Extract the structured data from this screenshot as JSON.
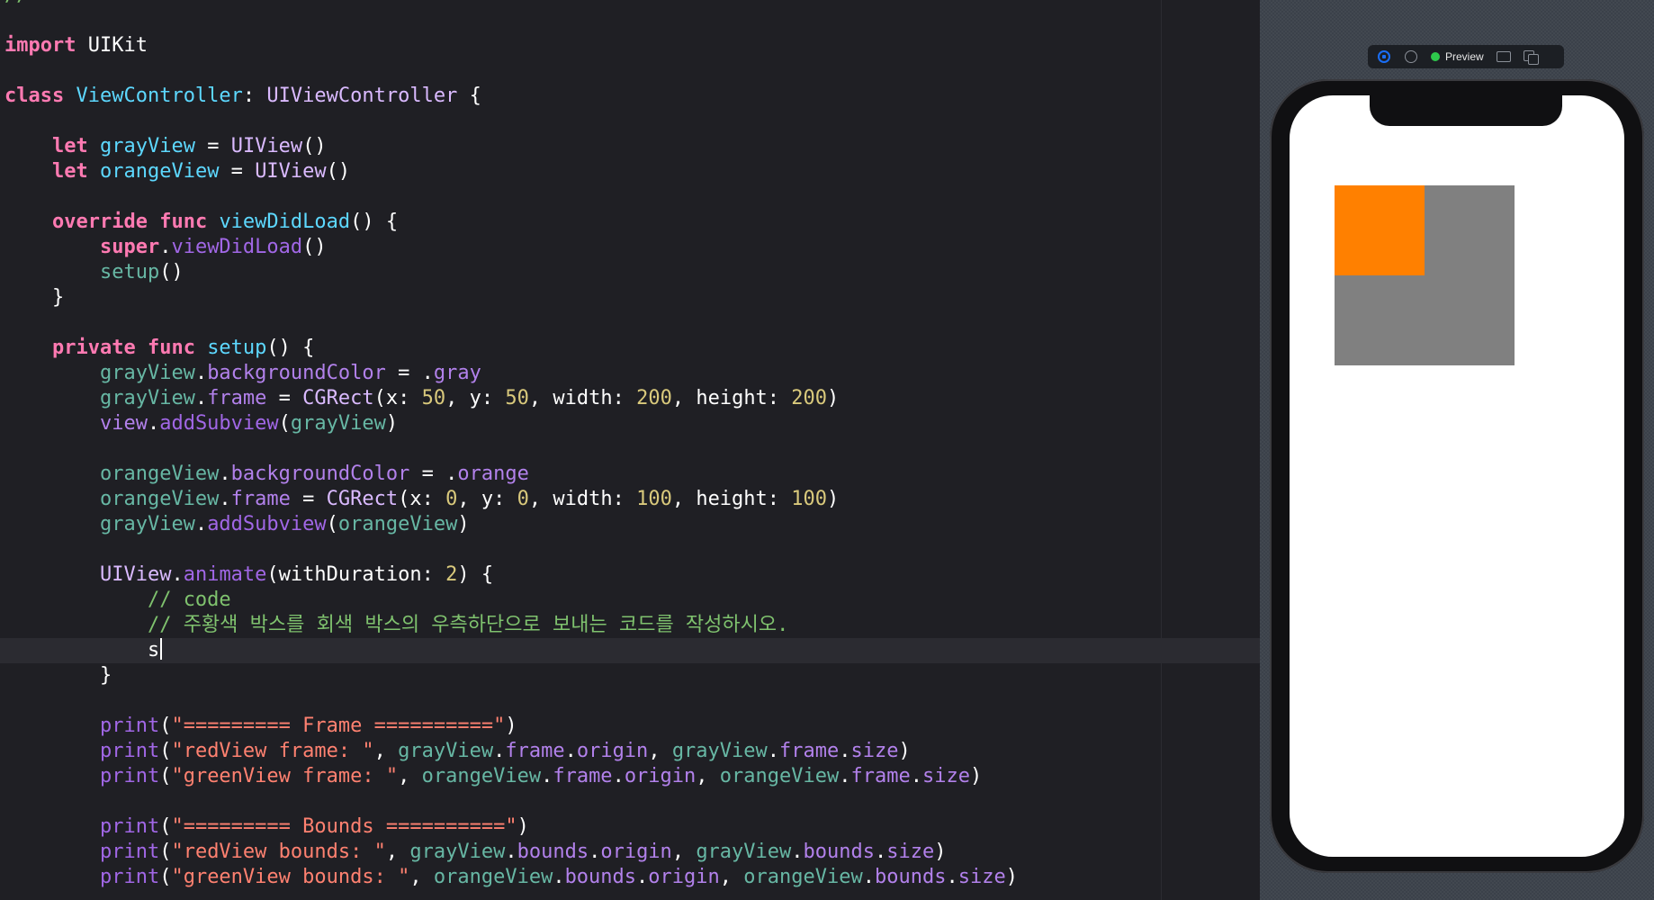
{
  "editor": {
    "lines": [
      [
        {
          "c": "cmt",
          "t": "//"
        }
      ],
      [],
      [
        {
          "c": "kw",
          "t": "import"
        },
        {
          "c": "plain",
          "t": " UIKit"
        }
      ],
      [],
      [
        {
          "c": "kw",
          "t": "class"
        },
        {
          "c": "plain",
          "t": " "
        },
        {
          "c": "type",
          "t": "ViewController"
        },
        {
          "c": "plain",
          "t": ": "
        },
        {
          "c": "cls",
          "t": "UIViewController"
        },
        {
          "c": "plain",
          "t": " {"
        }
      ],
      [],
      [
        {
          "c": "plain",
          "t": "    "
        },
        {
          "c": "kw",
          "t": "let"
        },
        {
          "c": "plain",
          "t": " "
        },
        {
          "c": "type",
          "t": "grayView"
        },
        {
          "c": "plain",
          "t": " = "
        },
        {
          "c": "cls",
          "t": "UIView"
        },
        {
          "c": "plain",
          "t": "()"
        }
      ],
      [
        {
          "c": "plain",
          "t": "    "
        },
        {
          "c": "kw",
          "t": "let"
        },
        {
          "c": "plain",
          "t": " "
        },
        {
          "c": "type",
          "t": "orangeView"
        },
        {
          "c": "plain",
          "t": " = "
        },
        {
          "c": "cls",
          "t": "UIView"
        },
        {
          "c": "plain",
          "t": "()"
        }
      ],
      [],
      [
        {
          "c": "plain",
          "t": "    "
        },
        {
          "c": "kw",
          "t": "override"
        },
        {
          "c": "plain",
          "t": " "
        },
        {
          "c": "kw",
          "t": "func"
        },
        {
          "c": "plain",
          "t": " "
        },
        {
          "c": "type",
          "t": "viewDidLoad"
        },
        {
          "c": "plain",
          "t": "() {"
        }
      ],
      [
        {
          "c": "plain",
          "t": "        "
        },
        {
          "c": "kw",
          "t": "super"
        },
        {
          "c": "plain",
          "t": "."
        },
        {
          "c": "sysfn",
          "t": "viewDidLoad"
        },
        {
          "c": "plain",
          "t": "()"
        }
      ],
      [
        {
          "c": "plain",
          "t": "        "
        },
        {
          "c": "id",
          "t": "setup"
        },
        {
          "c": "plain",
          "t": "()"
        }
      ],
      [
        {
          "c": "plain",
          "t": "    }"
        }
      ],
      [],
      [
        {
          "c": "plain",
          "t": "    "
        },
        {
          "c": "kw",
          "t": "private"
        },
        {
          "c": "plain",
          "t": " "
        },
        {
          "c": "kw",
          "t": "func"
        },
        {
          "c": "plain",
          "t": " "
        },
        {
          "c": "type",
          "t": "setup"
        },
        {
          "c": "plain",
          "t": "() {"
        }
      ],
      [
        {
          "c": "plain",
          "t": "        "
        },
        {
          "c": "id",
          "t": "grayView"
        },
        {
          "c": "plain",
          "t": "."
        },
        {
          "c": "mem",
          "t": "backgroundColor"
        },
        {
          "c": "plain",
          "t": " = ."
        },
        {
          "c": "mem",
          "t": "gray"
        }
      ],
      [
        {
          "c": "plain",
          "t": "        "
        },
        {
          "c": "id",
          "t": "grayView"
        },
        {
          "c": "plain",
          "t": "."
        },
        {
          "c": "mem",
          "t": "frame"
        },
        {
          "c": "plain",
          "t": " = "
        },
        {
          "c": "cls",
          "t": "CGRect"
        },
        {
          "c": "plain",
          "t": "(x: "
        },
        {
          "c": "num",
          "t": "50"
        },
        {
          "c": "plain",
          "t": ", y: "
        },
        {
          "c": "num",
          "t": "50"
        },
        {
          "c": "plain",
          "t": ", width: "
        },
        {
          "c": "num",
          "t": "200"
        },
        {
          "c": "plain",
          "t": ", height: "
        },
        {
          "c": "num",
          "t": "200"
        },
        {
          "c": "plain",
          "t": ")"
        }
      ],
      [
        {
          "c": "plain",
          "t": "        "
        },
        {
          "c": "mem",
          "t": "view"
        },
        {
          "c": "plain",
          "t": "."
        },
        {
          "c": "sysfn",
          "t": "addSubview"
        },
        {
          "c": "plain",
          "t": "("
        },
        {
          "c": "id",
          "t": "grayView"
        },
        {
          "c": "plain",
          "t": ")"
        }
      ],
      [],
      [
        {
          "c": "plain",
          "t": "        "
        },
        {
          "c": "id",
          "t": "orangeView"
        },
        {
          "c": "plain",
          "t": "."
        },
        {
          "c": "mem",
          "t": "backgroundColor"
        },
        {
          "c": "plain",
          "t": " = ."
        },
        {
          "c": "mem",
          "t": "orange"
        }
      ],
      [
        {
          "c": "plain",
          "t": "        "
        },
        {
          "c": "id",
          "t": "orangeView"
        },
        {
          "c": "plain",
          "t": "."
        },
        {
          "c": "mem",
          "t": "frame"
        },
        {
          "c": "plain",
          "t": " = "
        },
        {
          "c": "cls",
          "t": "CGRect"
        },
        {
          "c": "plain",
          "t": "(x: "
        },
        {
          "c": "num",
          "t": "0"
        },
        {
          "c": "plain",
          "t": ", y: "
        },
        {
          "c": "num",
          "t": "0"
        },
        {
          "c": "plain",
          "t": ", width: "
        },
        {
          "c": "num",
          "t": "100"
        },
        {
          "c": "plain",
          "t": ", height: "
        },
        {
          "c": "num",
          "t": "100"
        },
        {
          "c": "plain",
          "t": ")"
        }
      ],
      [
        {
          "c": "plain",
          "t": "        "
        },
        {
          "c": "id",
          "t": "grayView"
        },
        {
          "c": "plain",
          "t": "."
        },
        {
          "c": "sysfn",
          "t": "addSubview"
        },
        {
          "c": "plain",
          "t": "("
        },
        {
          "c": "id",
          "t": "orangeView"
        },
        {
          "c": "plain",
          "t": ")"
        }
      ],
      [],
      [
        {
          "c": "plain",
          "t": "        "
        },
        {
          "c": "cls",
          "t": "UIView"
        },
        {
          "c": "plain",
          "t": "."
        },
        {
          "c": "sysfn",
          "t": "animate"
        },
        {
          "c": "plain",
          "t": "(withDuration: "
        },
        {
          "c": "num",
          "t": "2"
        },
        {
          "c": "plain",
          "t": ") {"
        }
      ],
      [
        {
          "c": "plain",
          "t": "            "
        },
        {
          "c": "cmt",
          "t": "// code"
        }
      ],
      [
        {
          "c": "plain",
          "t": "            "
        },
        {
          "c": "cmt",
          "t": "// 주황색 박스를 회색 박스의 우측하단으로 보내는 코드를 작성하시오."
        }
      ],
      [
        {
          "c": "plain",
          "t": "            s"
        }
      ],
      [
        {
          "c": "plain",
          "t": "        }"
        }
      ],
      [],
      [
        {
          "c": "plain",
          "t": "        "
        },
        {
          "c": "sysfn",
          "t": "print"
        },
        {
          "c": "plain",
          "t": "("
        },
        {
          "c": "str",
          "t": "\"========= Frame ==========\""
        },
        {
          "c": "plain",
          "t": ")"
        }
      ],
      [
        {
          "c": "plain",
          "t": "        "
        },
        {
          "c": "sysfn",
          "t": "print"
        },
        {
          "c": "plain",
          "t": "("
        },
        {
          "c": "str",
          "t": "\"redView frame: \""
        },
        {
          "c": "plain",
          "t": ", "
        },
        {
          "c": "id",
          "t": "grayView"
        },
        {
          "c": "plain",
          "t": "."
        },
        {
          "c": "mem",
          "t": "frame"
        },
        {
          "c": "plain",
          "t": "."
        },
        {
          "c": "mem",
          "t": "origin"
        },
        {
          "c": "plain",
          "t": ", "
        },
        {
          "c": "id",
          "t": "grayView"
        },
        {
          "c": "plain",
          "t": "."
        },
        {
          "c": "mem",
          "t": "frame"
        },
        {
          "c": "plain",
          "t": "."
        },
        {
          "c": "mem",
          "t": "size"
        },
        {
          "c": "plain",
          "t": ")"
        }
      ],
      [
        {
          "c": "plain",
          "t": "        "
        },
        {
          "c": "sysfn",
          "t": "print"
        },
        {
          "c": "plain",
          "t": "("
        },
        {
          "c": "str",
          "t": "\"greenView frame: \""
        },
        {
          "c": "plain",
          "t": ", "
        },
        {
          "c": "id",
          "t": "orangeView"
        },
        {
          "c": "plain",
          "t": "."
        },
        {
          "c": "mem",
          "t": "frame"
        },
        {
          "c": "plain",
          "t": "."
        },
        {
          "c": "mem",
          "t": "origin"
        },
        {
          "c": "plain",
          "t": ", "
        },
        {
          "c": "id",
          "t": "orangeView"
        },
        {
          "c": "plain",
          "t": "."
        },
        {
          "c": "mem",
          "t": "frame"
        },
        {
          "c": "plain",
          "t": "."
        },
        {
          "c": "mem",
          "t": "size"
        },
        {
          "c": "plain",
          "t": ")"
        }
      ],
      [],
      [
        {
          "c": "plain",
          "t": "        "
        },
        {
          "c": "sysfn",
          "t": "print"
        },
        {
          "c": "plain",
          "t": "("
        },
        {
          "c": "str",
          "t": "\"========= Bounds ==========\""
        },
        {
          "c": "plain",
          "t": ")"
        }
      ],
      [
        {
          "c": "plain",
          "t": "        "
        },
        {
          "c": "sysfn",
          "t": "print"
        },
        {
          "c": "plain",
          "t": "("
        },
        {
          "c": "str",
          "t": "\"redView bounds: \""
        },
        {
          "c": "plain",
          "t": ", "
        },
        {
          "c": "id",
          "t": "grayView"
        },
        {
          "c": "plain",
          "t": "."
        },
        {
          "c": "mem",
          "t": "bounds"
        },
        {
          "c": "plain",
          "t": "."
        },
        {
          "c": "mem",
          "t": "origin"
        },
        {
          "c": "plain",
          "t": ", "
        },
        {
          "c": "id",
          "t": "grayView"
        },
        {
          "c": "plain",
          "t": "."
        },
        {
          "c": "mem",
          "t": "bounds"
        },
        {
          "c": "plain",
          "t": "."
        },
        {
          "c": "mem",
          "t": "size"
        },
        {
          "c": "plain",
          "t": ")"
        }
      ],
      [
        {
          "c": "plain",
          "t": "        "
        },
        {
          "c": "sysfn",
          "t": "print"
        },
        {
          "c": "plain",
          "t": "("
        },
        {
          "c": "str",
          "t": "\"greenView bounds: \""
        },
        {
          "c": "plain",
          "t": ", "
        },
        {
          "c": "id",
          "t": "orangeView"
        },
        {
          "c": "plain",
          "t": "."
        },
        {
          "c": "mem",
          "t": "bounds"
        },
        {
          "c": "plain",
          "t": "."
        },
        {
          "c": "mem",
          "t": "origin"
        },
        {
          "c": "plain",
          "t": ", "
        },
        {
          "c": "id",
          "t": "orangeView"
        },
        {
          "c": "plain",
          "t": "."
        },
        {
          "c": "mem",
          "t": "bounds"
        },
        {
          "c": "plain",
          "t": "."
        },
        {
          "c": "mem",
          "t": "size"
        },
        {
          "c": "plain",
          "t": ")"
        }
      ]
    ],
    "current_line_index": 26
  },
  "preview": {
    "label": "Preview",
    "live_icon": "live-preview-icon",
    "select_icon": "selectable-mode-icon",
    "device_icon": "device-settings-icon",
    "duplicate_icon": "duplicate-preview-icon",
    "gray_view_color": "#808080",
    "orange_view_color": "#ff8000",
    "screen_color": "#ffffff"
  },
  "colors": {
    "editor_bg": "#1f1f24",
    "current_line": "#2b2b31",
    "keyword": "#ff7ab2",
    "comment": "#7fc26e",
    "string": "#ff8170",
    "number": "#d9c97c",
    "status_green": "#2ec94c",
    "live_blue": "#1a6ef5"
  }
}
